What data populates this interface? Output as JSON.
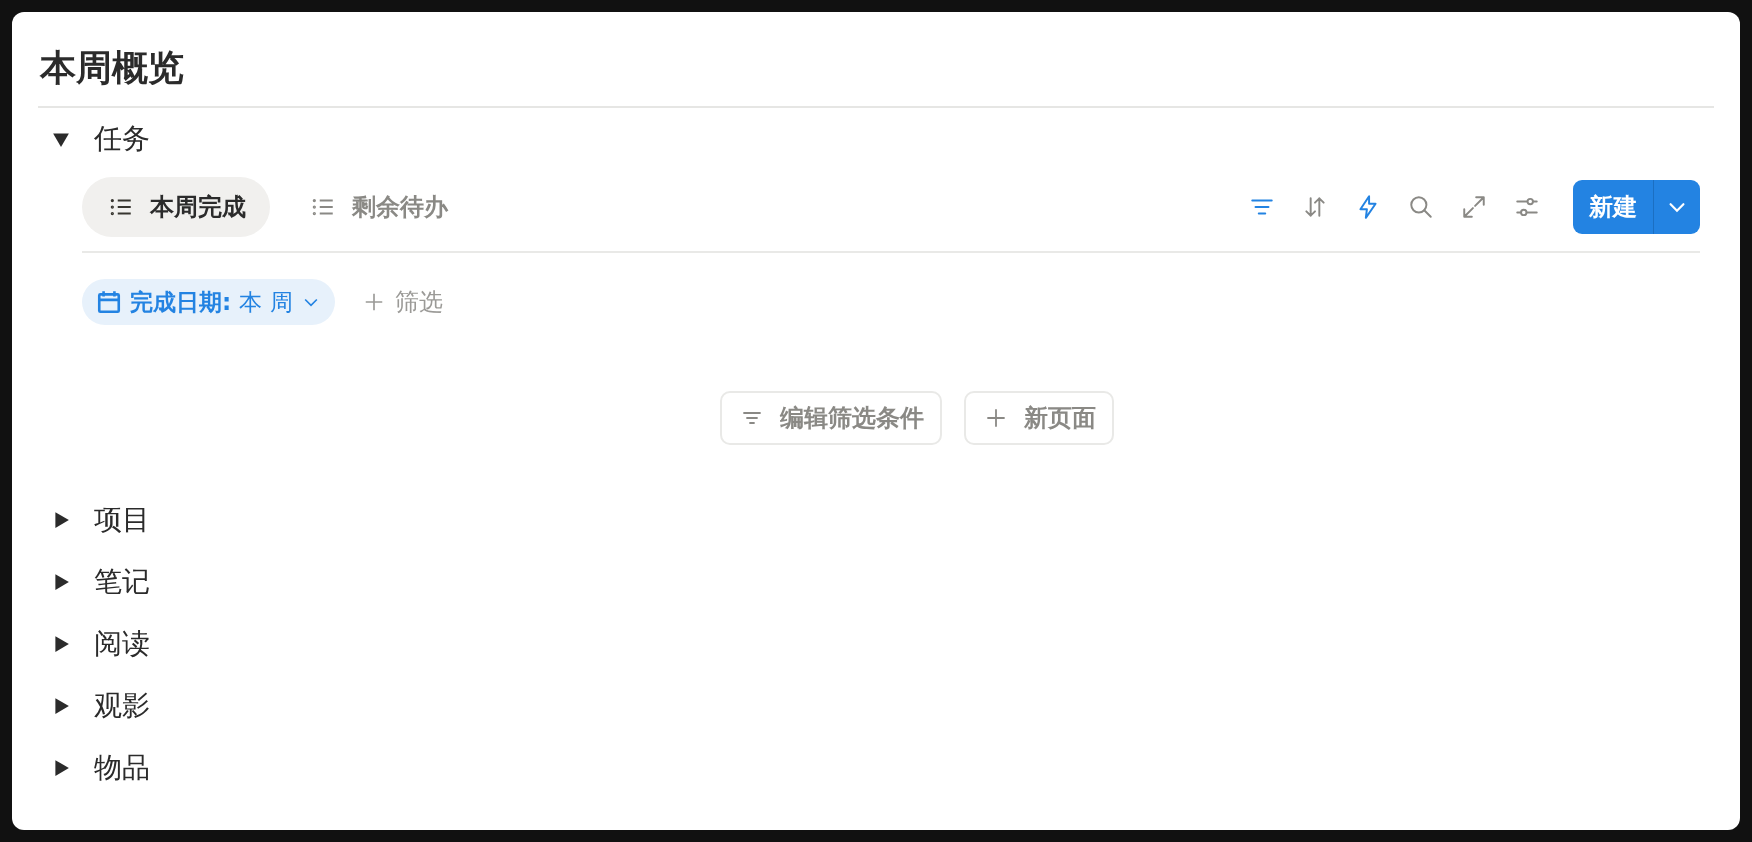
{
  "title": "本周概览",
  "sections": [
    {
      "label": "任务",
      "expanded": true,
      "views": [
        {
          "label": "本周完成",
          "selected": true
        },
        {
          "label": "剩余待办",
          "selected": false
        }
      ],
      "toolbar": [
        {
          "kind": "filter",
          "active": true
        },
        {
          "kind": "sort",
          "active": false
        },
        {
          "kind": "automation",
          "active": true
        },
        {
          "kind": "search",
          "active": false
        },
        {
          "kind": "expand",
          "active": false
        },
        {
          "kind": "settings",
          "active": false
        }
      ],
      "new_button": "新建",
      "filters": [
        {
          "field": "完成日期:",
          "value": "本 周"
        }
      ],
      "add_filter": "筛选",
      "empty_actions": [
        {
          "kind": "filter",
          "label": "编辑筛选条件"
        },
        {
          "kind": "add",
          "label": "新页面"
        }
      ]
    },
    {
      "label": "项目",
      "expanded": false
    },
    {
      "label": "笔记",
      "expanded": false
    },
    {
      "label": "阅读",
      "expanded": false
    },
    {
      "label": "观影",
      "expanded": false
    },
    {
      "label": "物品",
      "expanded": false
    }
  ]
}
